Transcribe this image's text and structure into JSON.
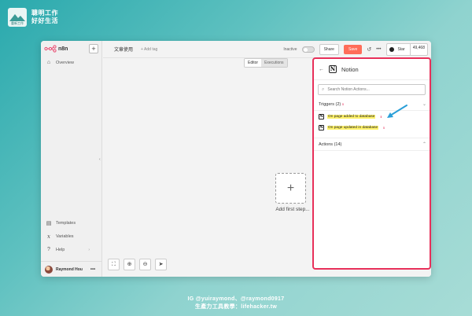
{
  "brand": {
    "line1": "聰明工作",
    "line2": "好好生活",
    "logo_caption": "重新工作"
  },
  "app": {
    "logo_text": "n8n"
  },
  "sidebar": {
    "overview": "Overview",
    "templates": "Templates",
    "variables": "Variables",
    "help": "Help",
    "user_name": "Raymond Hou"
  },
  "header": {
    "workflow_title": "文章使用",
    "add_tag": "+ Add tag",
    "inactive_label": "Inactive",
    "share_label": "Share",
    "save_label": "Save",
    "star_label": "Star",
    "star_count": "49,468"
  },
  "tabs": [
    {
      "label": "Editor"
    },
    {
      "label": "Executions"
    }
  ],
  "canvas": {
    "add_first_step": "Add first step..."
  },
  "panel": {
    "title": "Notion",
    "search_placeholder": "Search Notion Actions...",
    "triggers_header": "Triggers (2)",
    "triggers": [
      {
        "label": "On page added to database"
      },
      {
        "label": "On page updated in database"
      }
    ],
    "actions_header": "Actions (14)"
  },
  "footer": {
    "line1": "IG @yuiraymond、@raymond0917",
    "line2": "生產力工具教學：lifehacker.tw"
  },
  "colors": {
    "save": "#ff6d5a",
    "panel_border": "#e8305a",
    "highlight": "#fff36b",
    "arrow": "#2a9fd8"
  }
}
